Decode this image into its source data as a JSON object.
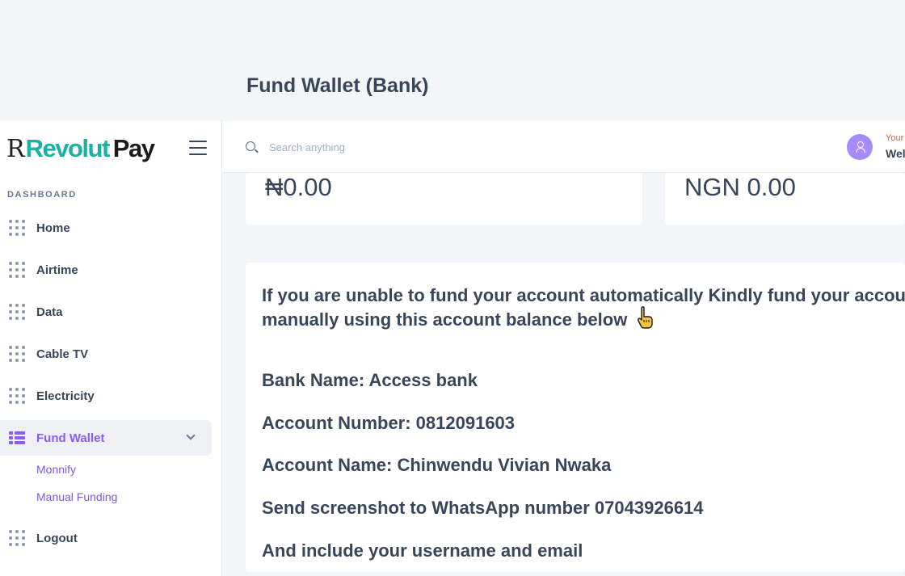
{
  "page": {
    "title": "Fund Wallet (Bank)"
  },
  "sidebar": {
    "logo": {
      "mark": "R",
      "revolut": "Revolut",
      "pay": "Pay"
    },
    "section_label": "DASHBOARD",
    "items": [
      {
        "label": "Home",
        "icon": "dots-grid-icon"
      },
      {
        "label": "Airtime",
        "icon": "dots-grid-icon"
      },
      {
        "label": "Data",
        "icon": "dots-grid-icon"
      },
      {
        "label": "Cable TV",
        "icon": "dots-grid-icon"
      },
      {
        "label": "Electricity",
        "icon": "dots-grid-icon"
      },
      {
        "label": "Fund Wallet",
        "icon": "wallet-list-icon",
        "expanded": true
      },
      {
        "label": "Logout",
        "icon": "dots-grid-icon"
      }
    ],
    "fund_wallet_sub": [
      "Monnify",
      "Manual Funding"
    ]
  },
  "header": {
    "search": {
      "placeholder": "Search anything",
      "value": ""
    },
    "user": {
      "line1": "Your",
      "line2": "Wel"
    }
  },
  "balances": {
    "wallet": "₦0.00",
    "ngn": "NGN 0.00"
  },
  "info": {
    "heading": "If you are unable to fund your account automatically Kindly fund your account manually using this account balance below",
    "bank_name": "Bank Name: Access bank",
    "account_number": "Account Number: 0812091603",
    "account_name": "Account Name: Chinwendu Vivian Nwaka",
    "whatsapp": "Send screenshot to WhatsApp number 07043926614",
    "include": "And include your username and email"
  },
  "colors": {
    "accent": "#8b5cf6",
    "brand_teal": "#18b3a2",
    "text": "#39465a"
  }
}
